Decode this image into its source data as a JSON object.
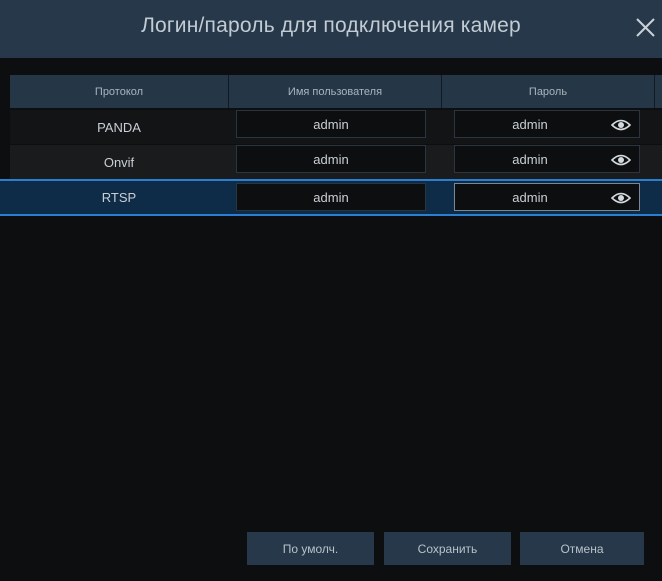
{
  "dialog": {
    "title": "Логин/пароль для подключения камер",
    "close_icon": "close-icon"
  },
  "table": {
    "columns": {
      "protocol": "Протокол",
      "username": "Имя пользователя",
      "password": "Пароль"
    },
    "rows": [
      {
        "protocol": "PANDA",
        "username": "admin",
        "password": "admin",
        "selected": false
      },
      {
        "protocol": "Onvif",
        "username": "admin",
        "password": "admin",
        "selected": false
      },
      {
        "protocol": "RTSP",
        "username": "admin",
        "password": "admin",
        "selected": true
      }
    ],
    "password_toggle_icon": "eye-icon"
  },
  "footer": {
    "default_label": "По умолч.",
    "save_label": "Сохранить",
    "cancel_label": "Отмена"
  },
  "colors": {
    "titlebar": "#263849",
    "selected_border": "#2a7fd0",
    "background": "#0d0e10"
  }
}
